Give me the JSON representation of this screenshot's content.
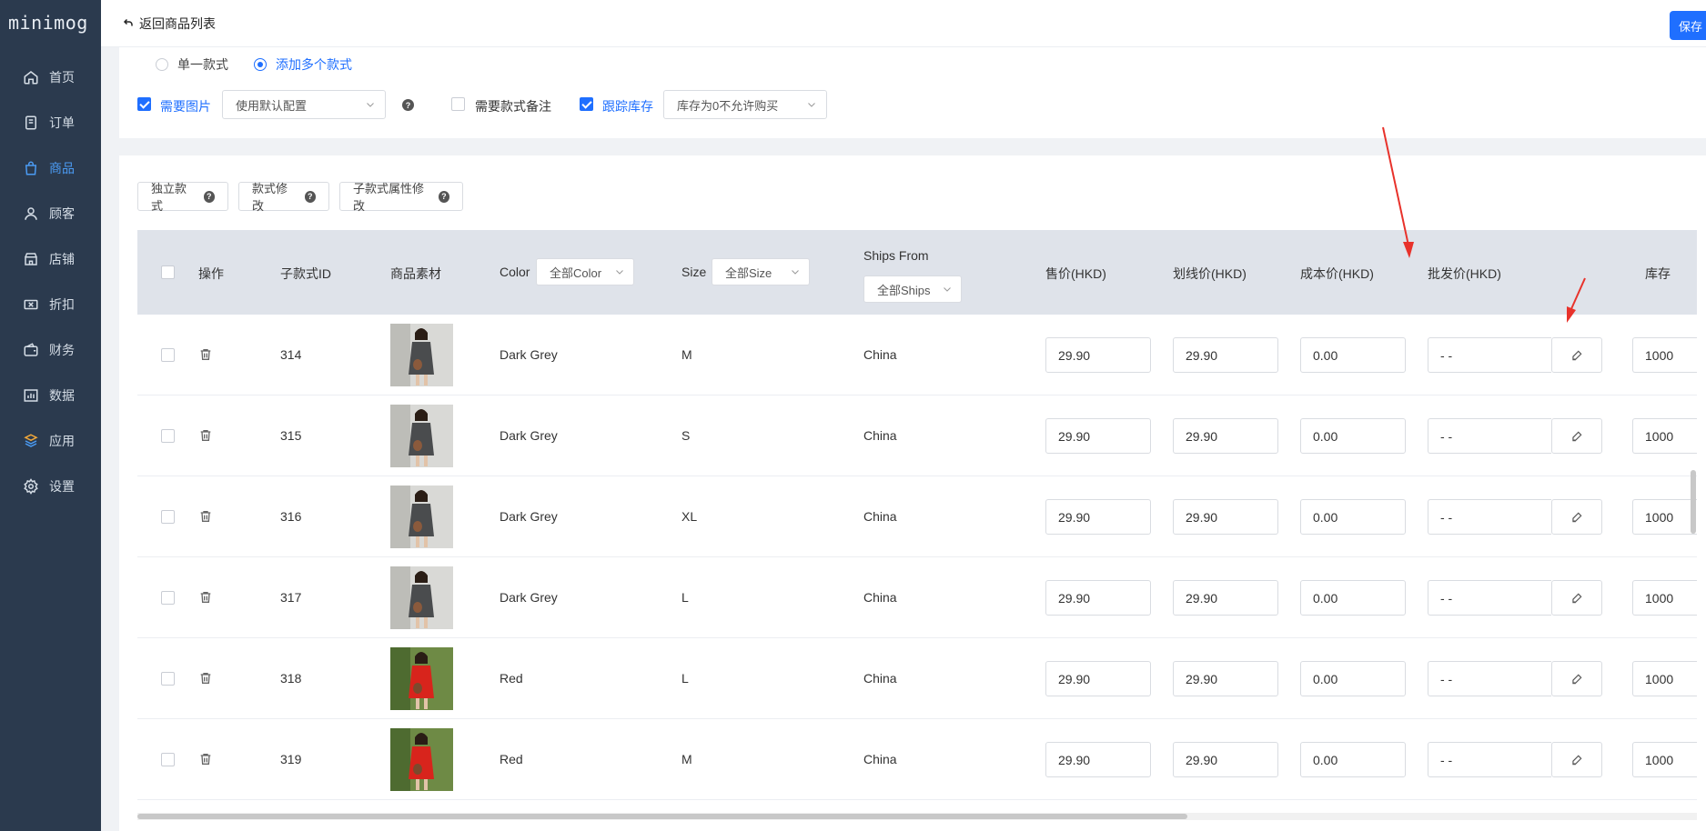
{
  "sidebar": {
    "logo": "minimog",
    "items": [
      {
        "label": "首页"
      },
      {
        "label": "订单"
      },
      {
        "label": "商品"
      },
      {
        "label": "顾客"
      },
      {
        "label": "店铺"
      },
      {
        "label": "折扣"
      },
      {
        "label": "财务"
      },
      {
        "label": "数据"
      },
      {
        "label": "应用"
      },
      {
        "label": "设置"
      }
    ],
    "active": "商品",
    "active_color": "#4b9bf3"
  },
  "header": {
    "back_label": "返回商品列表",
    "save_label": "保存"
  },
  "variant_mode": {
    "single_label": "单一款式",
    "multi_label": "添加多个款式",
    "selected": "添加多个款式"
  },
  "options": {
    "need_image_label": "需要图片",
    "need_image_checked": true,
    "image_config_value": "使用默认配置",
    "need_note_label": "需要款式备注",
    "need_note_checked": false,
    "track_stock_label": "跟踪库存",
    "track_stock_checked": true,
    "stock_policy_value": "库存为0不允许购买"
  },
  "toolbar": {
    "independent_label": "独立款式",
    "modify_label": "款式修改",
    "sub_attr_label": "子款式属性修改"
  },
  "table": {
    "headers": {
      "action": "操作",
      "sub_id": "子款式ID",
      "material": "商品素材",
      "color": "Color",
      "color_filter": "全部Color",
      "size": "Size",
      "size_filter": "全部Size",
      "ships_from": "Ships From",
      "ships_filter": "全部Ships",
      "price": "售价(HKD)",
      "compare_price": "划线价(HKD)",
      "cost": "成本价(HKD)",
      "wholesale": "批发价(HKD)",
      "stock": "库存"
    },
    "rows": [
      {
        "id": "314",
        "color": "Dark Grey",
        "size": "M",
        "ships": "China",
        "price": "29.90",
        "compare": "29.90",
        "cost": "0.00",
        "wholesale": "- -",
        "stock": "1000",
        "thumb": "grey"
      },
      {
        "id": "315",
        "color": "Dark Grey",
        "size": "S",
        "ships": "China",
        "price": "29.90",
        "compare": "29.90",
        "cost": "0.00",
        "wholesale": "- -",
        "stock": "1000",
        "thumb": "grey"
      },
      {
        "id": "316",
        "color": "Dark Grey",
        "size": "XL",
        "ships": "China",
        "price": "29.90",
        "compare": "29.90",
        "cost": "0.00",
        "wholesale": "- -",
        "stock": "1000",
        "thumb": "grey"
      },
      {
        "id": "317",
        "color": "Dark Grey",
        "size": "L",
        "ships": "China",
        "price": "29.90",
        "compare": "29.90",
        "cost": "0.00",
        "wholesale": "- -",
        "stock": "1000",
        "thumb": "grey"
      },
      {
        "id": "318",
        "color": "Red",
        "size": "L",
        "ships": "China",
        "price": "29.90",
        "compare": "29.90",
        "cost": "0.00",
        "wholesale": "- -",
        "stock": "1000",
        "thumb": "red"
      },
      {
        "id": "319",
        "color": "Red",
        "size": "M",
        "ships": "China",
        "price": "29.90",
        "compare": "29.90",
        "cost": "0.00",
        "wholesale": "- -",
        "stock": "1000",
        "thumb": "red"
      }
    ]
  },
  "colors": {
    "primary": "#1f6fff",
    "sidebar_bg": "#2b3a4e",
    "header_bg": "#dfe3ea",
    "annotation_arrow": "#e8322b"
  }
}
